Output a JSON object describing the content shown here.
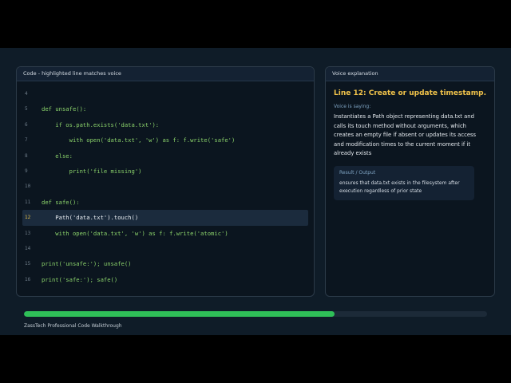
{
  "code_panel": {
    "header": "Code - highlighted line matches voice",
    "lines": [
      {
        "num": "4",
        "text": ""
      },
      {
        "num": "5",
        "text": "def unsafe():"
      },
      {
        "num": "6",
        "text": "    if os.path.exists('data.txt'):"
      },
      {
        "num": "7",
        "text": "        with open('data.txt', 'w') as f: f.write('safe')"
      },
      {
        "num": "8",
        "text": "    else:"
      },
      {
        "num": "9",
        "text": "        print('file missing')"
      },
      {
        "num": "10",
        "text": ""
      },
      {
        "num": "11",
        "text": "def safe():"
      },
      {
        "num": "12",
        "text": "    Path('data.txt').touch()",
        "highlighted": true
      },
      {
        "num": "13",
        "text": "    with open('data.txt', 'w') as f: f.write('atomic')"
      },
      {
        "num": "14",
        "text": ""
      },
      {
        "num": "15",
        "text": "print('unsafe:'); unsafe()"
      },
      {
        "num": "16",
        "text": "print('safe:'); safe()"
      }
    ]
  },
  "voice_panel": {
    "header": "Voice explanation",
    "title": "Line 12: Create or update timestamp...",
    "saying_label": "Voice is saying:",
    "saying_text": "Instantiates a Path object representing data.txt and calls its touch method without arguments, which creates an empty file if absent or updates its access and modification times to the current moment if it already exists",
    "result_label": "Result / Output",
    "result_text": "ensures that data.txt exists in the filesystem after execution regardless of prior state"
  },
  "progress": {
    "fraction": 0.67,
    "color": "#2fbf58"
  },
  "footer": {
    "label": "ZassTech Professional Code Walkthrough"
  }
}
